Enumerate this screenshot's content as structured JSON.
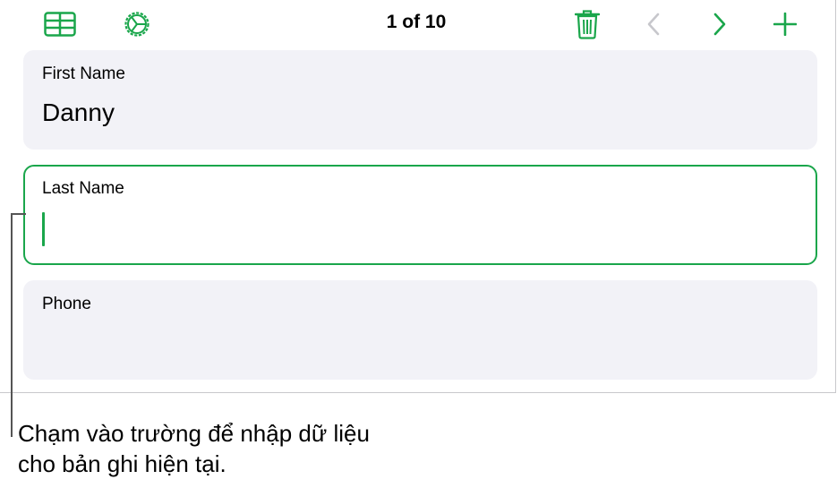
{
  "toolbar": {
    "table_icon": "table-icon",
    "settings_icon": "gear-icon",
    "record_counter": "1 of 10",
    "delete_icon": "trash-icon",
    "prev_icon": "chevron-left-icon",
    "next_icon": "chevron-right-icon",
    "add_icon": "plus-icon"
  },
  "fields": [
    {
      "label": "First Name",
      "value": "Danny"
    },
    {
      "label": "Last Name",
      "value": ""
    },
    {
      "label": "Phone",
      "value": ""
    }
  ],
  "callout": {
    "line1": "Chạm vào trường để nhập dữ liệu",
    "line2": "cho bản ghi hiện tại."
  },
  "colors": {
    "accent": "#1aa64b",
    "disabled": "#c7c7cc",
    "card_bg": "#f2f2f7"
  }
}
